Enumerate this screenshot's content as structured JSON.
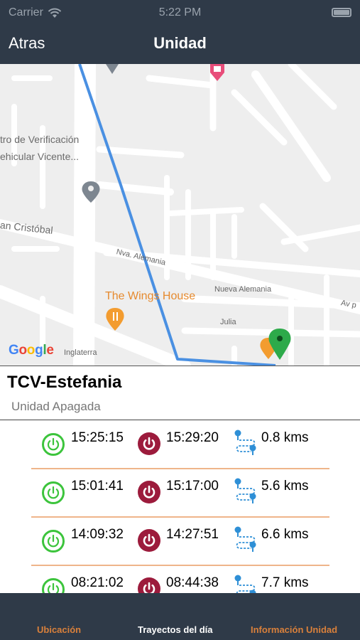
{
  "status_bar": {
    "carrier": "Carrier",
    "time": "5:22 PM"
  },
  "nav": {
    "back_label": "Atras",
    "title": "Unidad"
  },
  "map": {
    "labels": {
      "verif_line1": "tro de Verificación",
      "verif_line2": "ehicular Vicente...",
      "cristobal": "an Cristóbal",
      "nva_alemania": "Nva. Alemania",
      "wings": "The Wings House",
      "nueva_alemania": "Nueva Alemania",
      "julia": "Julia",
      "inglaterra": "Inglaterra",
      "av": "Av p"
    },
    "google_letters": [
      "G",
      "o",
      "o",
      "g",
      "l",
      "e"
    ]
  },
  "unit": {
    "name": "TCV-Estefania",
    "status": "Unidad Apagada"
  },
  "trips": [
    {
      "start": "15:25:15",
      "end": "15:29:20",
      "distance": "0.8 kms"
    },
    {
      "start": "15:01:41",
      "end": "15:17:00",
      "distance": "5.6 kms"
    },
    {
      "start": "14:09:32",
      "end": "14:27:51",
      "distance": "6.6 kms"
    },
    {
      "start": "08:21:02",
      "end": "08:44:38",
      "distance": "7.7 kms"
    }
  ],
  "tabs": {
    "location": "Ubicación",
    "trips": "Trayectos del día",
    "info": "Información Unidad"
  },
  "colors": {
    "bar_bg": "#2f3a48",
    "tab_active": "#d9803b",
    "power_on": "#3cc43c",
    "power_off": "#9c1b3c",
    "route_line": "#4a90e2",
    "separator": "#efb58a"
  },
  "icons": [
    "wifi-icon",
    "battery-icon",
    "power-on-icon",
    "power-off-icon",
    "route-icon",
    "map-pin-icon",
    "restaurant-pin-icon"
  ]
}
